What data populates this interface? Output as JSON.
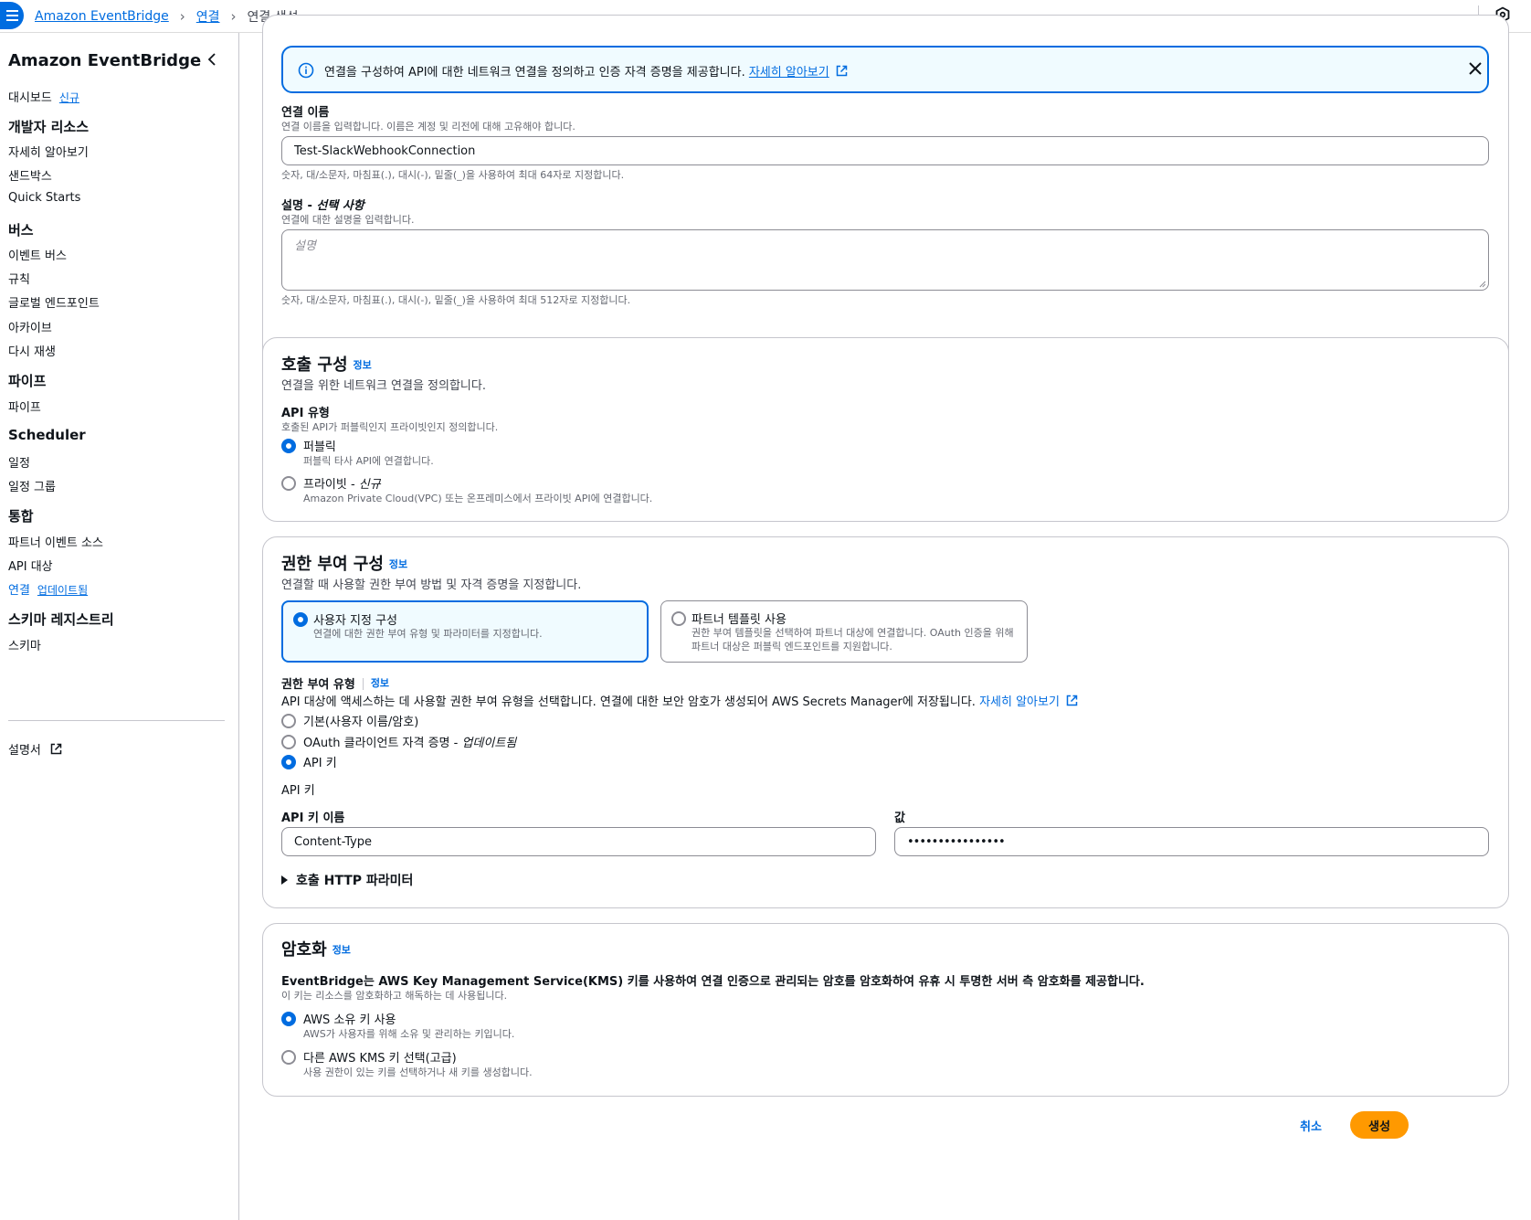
{
  "breadcrumb": {
    "items": [
      "Amazon EventBridge",
      "연결"
    ],
    "current": "연결 생성"
  },
  "sidebar": {
    "title": "Amazon EventBridge",
    "dashboard": {
      "label": "대시보드",
      "badge": "신규"
    },
    "sections": [
      {
        "heading": "개발자 리소스",
        "items": [
          "자세히 알아보기",
          "샌드박스",
          "Quick Starts"
        ]
      },
      {
        "heading": "버스",
        "items": [
          "이벤트 버스",
          "규칙",
          "글로벌 엔드포인트",
          "아카이브",
          "다시 재생"
        ]
      },
      {
        "heading": "파이프",
        "items": [
          "파이프"
        ]
      },
      {
        "heading": "Scheduler",
        "items": [
          "일정",
          "일정 그룹"
        ]
      },
      {
        "heading": "통합",
        "items": [
          "파트너 이벤트 소스",
          "API 대상"
        ]
      },
      {
        "heading": "스키마 레지스트리",
        "items": [
          "스키마"
        ]
      }
    ],
    "connections": {
      "label": "연결",
      "badge": "업데이트됨"
    },
    "docs": "설명서"
  },
  "banner": {
    "text": "연결을 구성하여 API에 대한 네트워크 연결을 정의하고 인증 자격 증명을 제공합니다.",
    "link": "자세히 알아보기"
  },
  "details": {
    "name_label": "연결 이름",
    "name_desc": "연결 이름을 입력합니다. 이름은 계정 및 리전에 대해 고유해야 합니다.",
    "name_value": "Test-SlackWebhookConnection",
    "name_hint": "숫자, 대/소문자, 마침표(.), 대시(-), 밑줄(_)을 사용하여 최대 64자로 지정합니다.",
    "desc_label": "설명 - ",
    "desc_optional": "선택 사항",
    "desc_desc": "연결에 대한 설명을 입력합니다.",
    "desc_placeholder": "설명",
    "desc_hint": "숫자, 대/소문자, 마침표(.), 대시(-), 밑줄(_)을 사용하여 최대 512자로 지정합니다."
  },
  "invocation": {
    "title": "호출 구성",
    "info": "정보",
    "desc": "연결을 위한 네트워크 연결을 정의합니다.",
    "api_type_label": "API 유형",
    "api_type_desc": "호출된 API가 퍼블릭인지 프라이빗인지 정의합니다.",
    "options": [
      {
        "label": "퍼블릭",
        "tag": "",
        "desc": "퍼블릭 타사 API에 연결합니다.",
        "selected": true
      },
      {
        "label": "프라이빗 - ",
        "tag": "신규",
        "desc": "Amazon Private Cloud(VPC) 또는 온프레미스에서 프라이빗 API에 연결합니다.",
        "selected": false
      }
    ]
  },
  "authorization": {
    "title": "권한 부여 구성",
    "info": "정보",
    "desc": "연결할 때 사용할 권한 부여 방법 및 자격 증명을 지정합니다.",
    "tiles": [
      {
        "label": "사용자 지정 구성",
        "desc": "연결에 대한 권한 부여 유형 및 파라미터를 지정합니다.",
        "selected": true
      },
      {
        "label": "파트너 템플릿 사용",
        "desc": "권한 부여 템플릿을 선택하여 파트너 대상에 연결합니다. OAuth 인증을 위해 파트너 대상은 퍼블릭 엔드포인트를 지원합니다.",
        "selected": false
      }
    ],
    "type_label": "권한 부여 유형",
    "type_info": "정보",
    "type_desc": "API 대상에 액세스하는 데 사용할 권한 부여 유형을 선택합니다. 연결에 대한 보안 암호가 생성되어 AWS Secrets Manager에 저장됩니다.",
    "type_link": "자세히 알아보기",
    "types": [
      {
        "label": "기본(사용자 이름/암호)",
        "tag": "",
        "selected": false
      },
      {
        "label": "OAuth 클라이언트 자격 증명 - ",
        "tag": "업데이트됨",
        "selected": false
      },
      {
        "label": "API 키",
        "tag": "",
        "selected": true
      }
    ],
    "api_key_heading": "API 키",
    "key_name_label": "API 키 이름",
    "key_name_value": "Content-Type",
    "value_label": "값",
    "value_value": "••••••••••••••••",
    "http_params": "호출 HTTP 파라미터"
  },
  "encryption": {
    "title": "암호화",
    "info": "정보",
    "desc_bold": "EventBridge는 AWS Key Management Service(KMS) 키를 사용하여 연결 인증으로 관리되는 암호를 암호화하여 유휴 시 투명한 서버 측 암호화를 제공합니다.",
    "desc": "이 키는 리소스를 암호화하고 해독하는 데 사용됩니다.",
    "options": [
      {
        "label": "AWS 소유 키 사용",
        "desc": "AWS가 사용자를 위해 소유 및 관리하는 키입니다.",
        "selected": true
      },
      {
        "label": "다른 AWS KMS 키 선택(고급)",
        "desc": "사용 권한이 있는 키를 선택하거나 새 키를 생성합니다.",
        "selected": false
      }
    ]
  },
  "actions": {
    "cancel": "취소",
    "create": "생성"
  },
  "colors": {
    "accent": "#006ce0",
    "primary_button": "#ff9900",
    "border": "#c6c6cd"
  },
  "icons": [
    "menu-icon",
    "chevron-right-icon",
    "notifications-icon",
    "chevron-left-icon",
    "external-link-icon",
    "info-circle-icon",
    "close-icon",
    "caret-right-icon"
  ]
}
